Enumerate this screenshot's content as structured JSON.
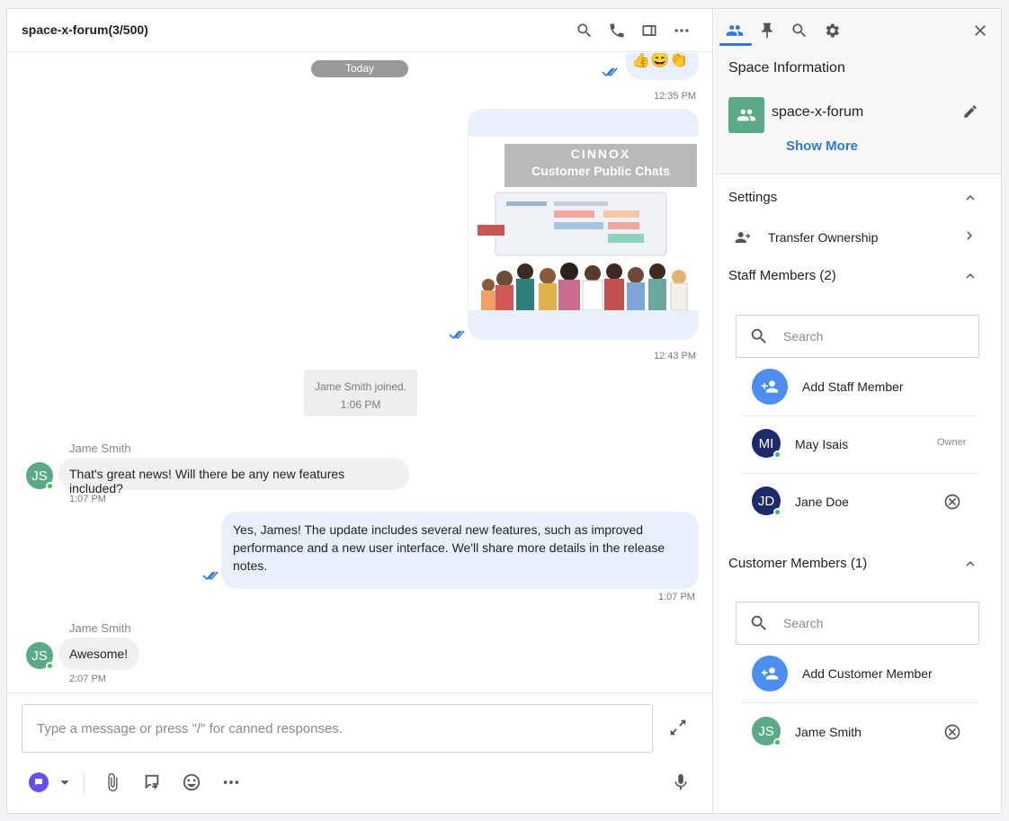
{
  "chat": {
    "title": "space-x-forum(3/500)",
    "date_pill": "Today",
    "messages": [
      {
        "type": "outgoing-emoji",
        "content": "👍😄👏",
        "time": "12:35 PM"
      },
      {
        "type": "outgoing-image",
        "image_brand": "CINNOX",
        "image_title": "Customer Public Chats",
        "time": "12:43 PM"
      },
      {
        "type": "system",
        "text": "Jame Smith joined.",
        "time": "1:06 PM"
      },
      {
        "type": "incoming",
        "sender": "Jame Smith",
        "initials": "JS",
        "text": "That's great news! Will there be any new features included?",
        "time": "1:07 PM"
      },
      {
        "type": "outgoing",
        "text_line1": "Yes, James! The update includes several new features, such as improved",
        "text_line2": "performance and a new user interface. We'll share more details in the release",
        "text_line3": "notes.",
        "time": "1:07 PM"
      },
      {
        "type": "incoming",
        "sender": "Jame Smith",
        "initials": "JS",
        "text": "Awesome!",
        "time": "2:07 PM"
      }
    ],
    "composer": {
      "placeholder": "Type a message or press \"/\" for canned responses."
    }
  },
  "side": {
    "space_info_title": "Space Information",
    "space_name": "space-x-forum",
    "show_more": "Show More",
    "settings_title": "Settings",
    "transfer_ownership": "Transfer Ownership",
    "staff_title": "Staff Members (2)",
    "staff_search_placeholder": "Search",
    "add_staff": "Add Staff Member",
    "staff": [
      {
        "initials": "MI",
        "name": "May Isais",
        "role": "Owner"
      },
      {
        "initials": "JD",
        "name": "Jane Doe",
        "role": ""
      }
    ],
    "customer_title": "Customer Members (1)",
    "customer_search_placeholder": "Search",
    "add_customer": "Add Customer Member",
    "customers": [
      {
        "initials": "JS",
        "name": "Jame Smith"
      }
    ]
  },
  "colors": {
    "accent": "#2f7bd9",
    "avatar_green": "#5aaa87",
    "avatar_navy": "#1e2b6b",
    "outgoing_bubble": "#e8f0fd",
    "online": "#35c759"
  }
}
